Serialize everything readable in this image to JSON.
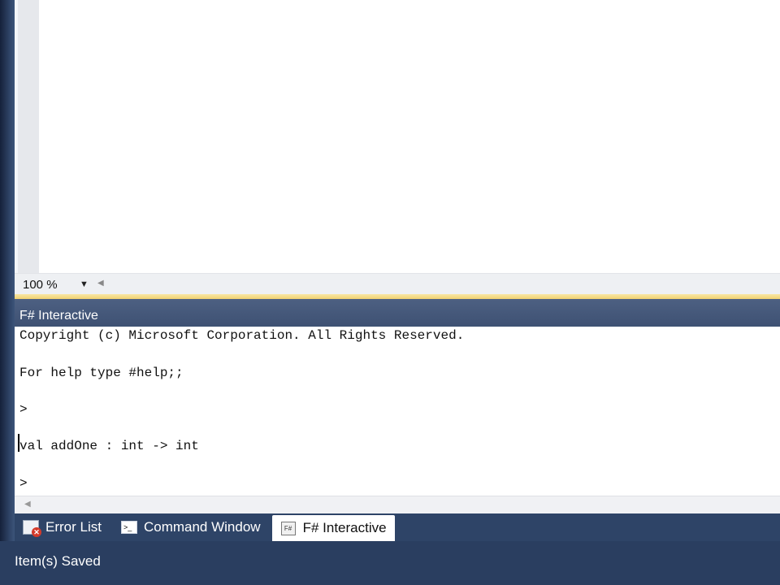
{
  "editor": {
    "zoom_value": "100 %"
  },
  "fsi_panel": {
    "title": "F# Interactive",
    "lines": [
      "Copyright (c) Microsoft Corporation. All Rights Reserved.",
      "",
      "For help type #help;;",
      "",
      ">",
      "",
      "val addOne : int -> int",
      "",
      ">"
    ]
  },
  "tabs": [
    {
      "label": "Error List",
      "icon": "error-list-icon"
    },
    {
      "label": "Command Window",
      "icon": "command-window-icon"
    },
    {
      "label": "F# Interactive",
      "icon": "fsharp-interactive-icon",
      "active": true
    }
  ],
  "status": {
    "text": "Item(s) Saved"
  },
  "colors": {
    "frame": "#2b3c59",
    "titlebar": "#4d6082",
    "splitter": "#f0d070"
  }
}
